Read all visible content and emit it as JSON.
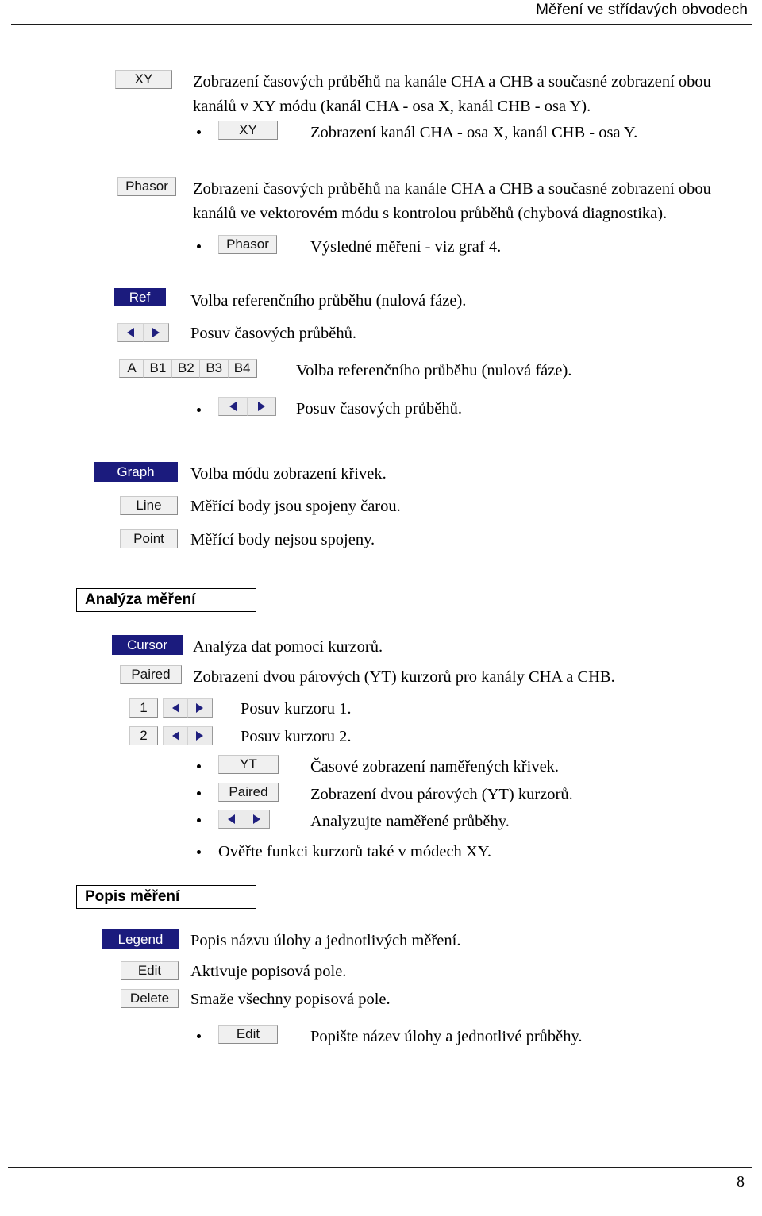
{
  "header": {
    "title": "Měření ve střídavých obvodech"
  },
  "footer": {
    "page_number": "8"
  },
  "colors": {
    "accent_navy": "#1b1b7d",
    "button_face": "#f0f0f0",
    "button_border": "#8c8c8c",
    "text": "#000000"
  },
  "blocks": {
    "xy": {
      "button_label": "XY",
      "description": "Zobrazení časových průběhů na kanále CHA a CHB a současné zobrazení obou\nkanálů v XY módu (kanál CHA - osa X, kanál CHB - osa Y).",
      "sub": {
        "button_label": "XY",
        "description": "Zobrazení   kanál CHA - osa X, kanál CHB - osa Y."
      }
    },
    "phasor": {
      "button_label": "Phasor",
      "description": "Zobrazení časových průběhů na kanále CHA a CHB a současné zobrazení obou\nkanálů ve vektorovém módu  s kontrolou průběhů (chybová diagnostika).",
      "sub": {
        "button_label": "Phasor",
        "description": "Výsledné měření - viz graf 4."
      }
    },
    "ref": {
      "button_label": "Ref",
      "description": "Volba referenčního průběhu (nulová fáze).",
      "shift": {
        "arrow_left": "left-arrow-icon",
        "arrow_right": "right-arrow-icon",
        "description": "Posuv časových průběhů."
      },
      "channels": {
        "segments": [
          "A",
          "B1",
          "B2",
          "B3",
          "B4"
        ],
        "description": "Volba referenčního průběhu (nulová fáze)."
      },
      "channel_shift": {
        "arrow_left": "left-arrow-icon",
        "arrow_right": "right-arrow-icon",
        "description": "Posuv časových průběhů."
      }
    },
    "graph": {
      "button_label": "Graph",
      "description": "Volba módu zobrazení křivek.",
      "line": {
        "button_label": "Line",
        "description": "Měřící body jsou spojeny čarou."
      },
      "point": {
        "button_label": "Point",
        "description": "Měřící body nejsou spojeny."
      }
    },
    "analysis_section": {
      "title": "Analýza měření",
      "cursor": {
        "button_label": "Cursor",
        "description": "Analýza dat pomocí kurzorů."
      },
      "paired": {
        "button_label": "Paired",
        "description": "Zobrazení dvou párových (YT) kurzorů pro kanály CHA a CHB."
      },
      "cursor1": {
        "button_label": "1",
        "description": "Posuv kurzoru 1."
      },
      "cursor2": {
        "button_label": "2",
        "description": "Posuv kurzoru 2."
      },
      "sub_yt": {
        "button_label": "YT",
        "description": "Časové zobrazení naměřených křivek."
      },
      "sub_paired": {
        "button_label": "Paired",
        "description": "Zobrazení dvou párových (YT) kurzorů."
      },
      "sub_arrows": {
        "description": "Analyzujte naměřené průběhy."
      },
      "sub_note": {
        "description": "Ověřte funkci kurzorů také v módech XY."
      }
    },
    "description_section": {
      "title": "Popis měření",
      "legend": {
        "button_label": "Legend",
        "description": "Popis názvu úlohy a jednotlivých měření."
      },
      "edit": {
        "button_label": "Edit",
        "description": "Aktivuje popisová pole."
      },
      "delete": {
        "button_label": "Delete",
        "description": "Smaže všechny popisová pole."
      },
      "sub_edit": {
        "button_label": "Edit",
        "description": "Popište název úlohy a jednotlivé průběhy."
      }
    }
  }
}
